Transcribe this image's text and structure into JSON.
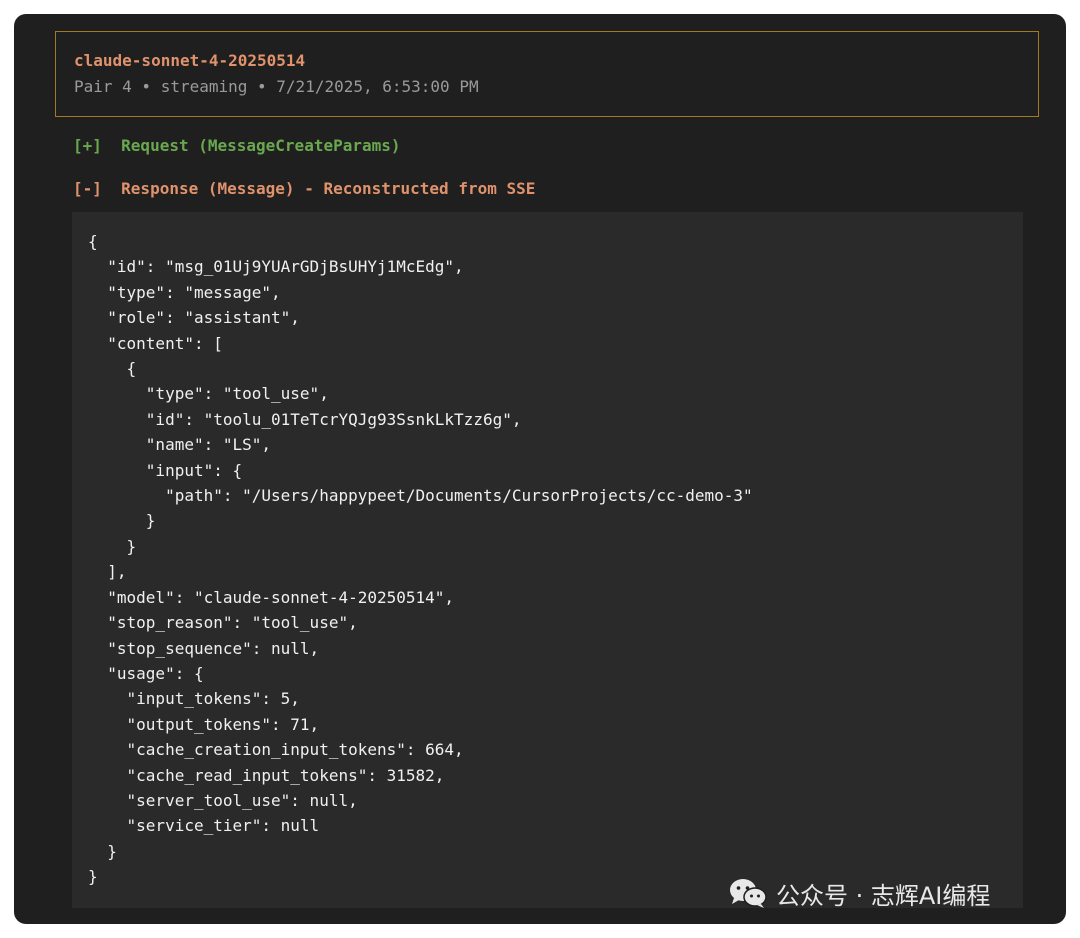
{
  "header": {
    "model": "claude-sonnet-4-20250514",
    "meta": "Pair 4 • streaming • 7/21/2025, 6:53:00 PM"
  },
  "request_toggle": {
    "label": "[+]  Request (MessageCreateParams)"
  },
  "response_toggle": {
    "label": "[-]  Response (Message) - Reconstructed from SSE"
  },
  "response_json": "{\n  \"id\": \"msg_01Uj9YUArGDjBsUHYj1McEdg\",\n  \"type\": \"message\",\n  \"role\": \"assistant\",\n  \"content\": [\n    {\n      \"type\": \"tool_use\",\n      \"id\": \"toolu_01TeTcrYQJg93SsnkLkTzz6g\",\n      \"name\": \"LS\",\n      \"input\": {\n        \"path\": \"/Users/happypeet/Documents/CursorProjects/cc-demo-3\"\n      }\n    }\n  ],\n  \"model\": \"claude-sonnet-4-20250514\",\n  \"stop_reason\": \"tool_use\",\n  \"stop_sequence\": null,\n  \"usage\": {\n    \"input_tokens\": 5,\n    \"output_tokens\": 71,\n    \"cache_creation_input_tokens\": 664,\n    \"cache_read_input_tokens\": 31582,\n    \"server_tool_use\": null,\n    \"service_tier\": null\n  }\n}",
  "watermark": {
    "text": "公众号 · 志辉AI编程",
    "icon": "wechat-icon"
  },
  "colors": {
    "frame_bg": "#1f1f1f",
    "code_bg": "#2a2a2a",
    "accent_orange": "#e0926c",
    "accent_green": "#6aa84f",
    "header_border": "#a47a1e"
  }
}
